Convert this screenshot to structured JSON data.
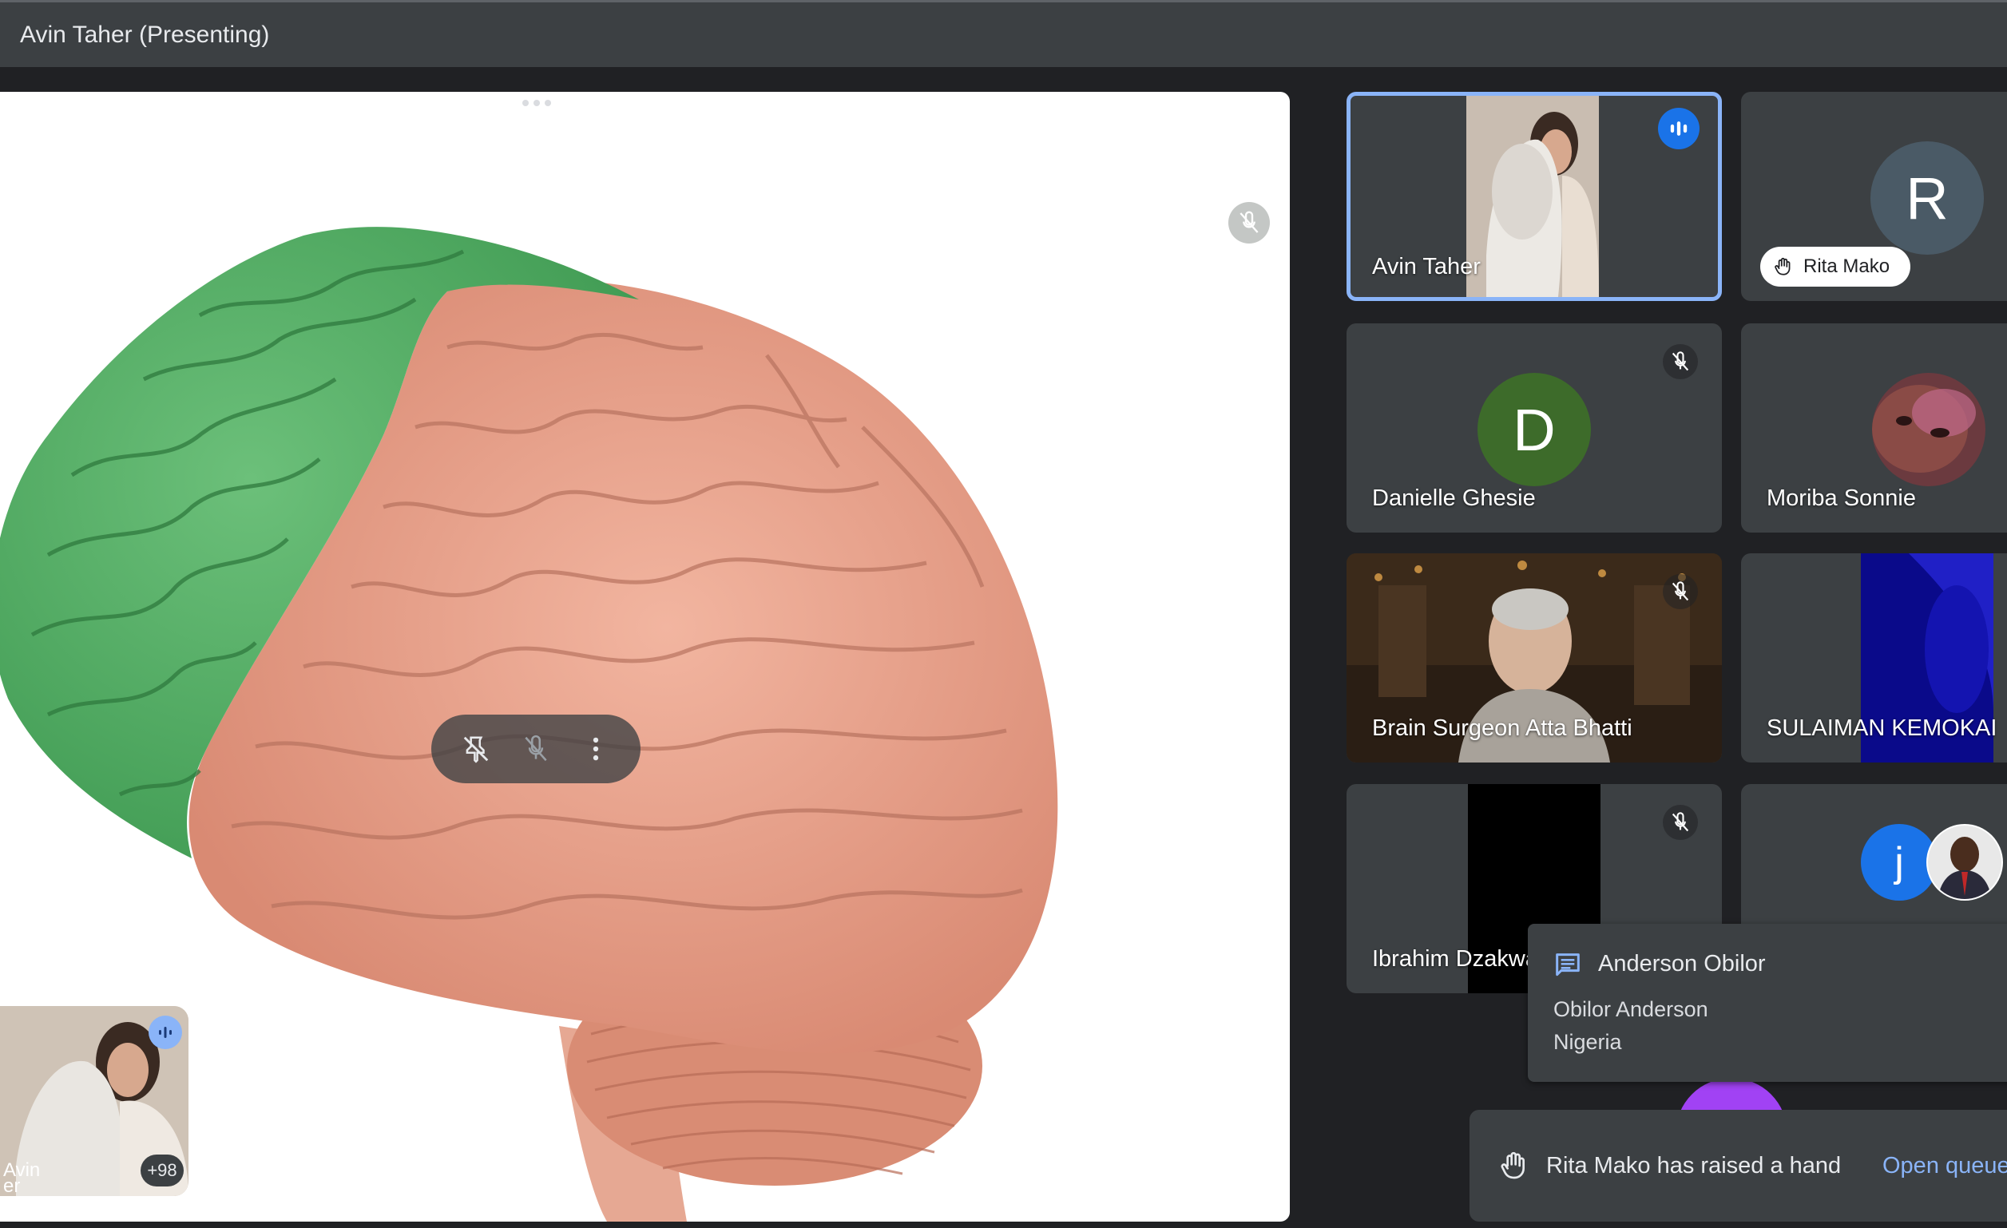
{
  "header": {
    "title": "Avin Taher (Presenting)"
  },
  "self_view": {
    "name": "Avin\ner",
    "extra_count": "+98"
  },
  "tiles": [
    {
      "name": "Avin Taher",
      "state": "speaking"
    },
    {
      "name": "Rita Mako",
      "avatar_letter": "R",
      "avatar_color": "#4a5a66",
      "hand_raised": true
    },
    {
      "name": "Danielle Ghesie",
      "avatar_letter": "D",
      "avatar_color": "#3d6b2a",
      "muted": true
    },
    {
      "name": "Moriba Sonnie"
    },
    {
      "name": "Brain Surgeon Atta Bhatti",
      "muted": true
    },
    {
      "name": "SULAIMAN KEMOKAI"
    },
    {
      "name": "Ibrahim Dzakwa",
      "muted": true
    },
    {
      "name": "",
      "avatar_letter": "j",
      "avatar_color": "#1a73e8"
    }
  ],
  "chat_notification": {
    "sender": "Anderson Obilor",
    "lines": [
      "Obilor Anderson",
      "Nigeria"
    ]
  },
  "hand_toast": {
    "message": "Rita Mako has raised a hand",
    "action": "Open queue"
  },
  "colors": {
    "accent": "#8ab4f8",
    "speaking": "#1a73e8",
    "background": "#202124",
    "tile": "#3c4043"
  }
}
